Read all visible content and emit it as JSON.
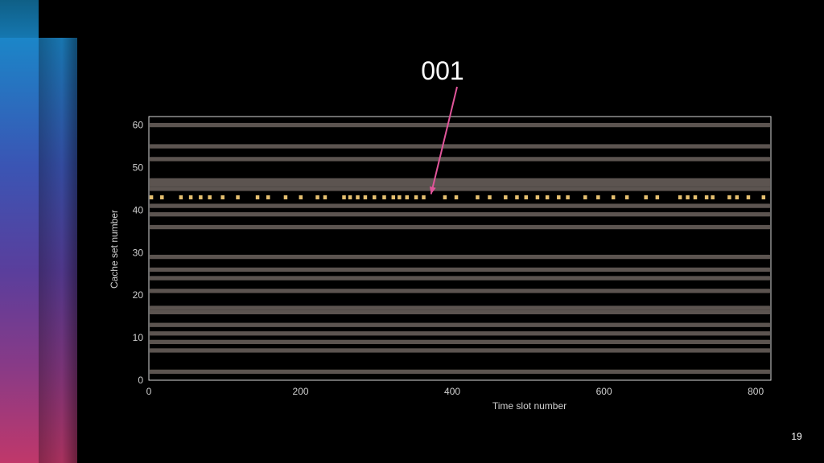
{
  "slide": {
    "title": "001",
    "page_number": "19"
  },
  "colors": {
    "background": "#000000",
    "band": "#5c5450",
    "band_dark": "#3e3835",
    "highlight": "#e6c070",
    "arrow": "#e0559a",
    "frame": "#d8d8d8"
  },
  "chart_data": {
    "type": "heatmap",
    "xlabel": "Time slot number",
    "ylabel": "Cache set number",
    "xlim": [
      0,
      820
    ],
    "ylim": [
      0,
      62
    ],
    "xticks": [
      0,
      200,
      400,
      600,
      800
    ],
    "yticks": [
      0,
      10,
      20,
      30,
      40,
      50,
      60
    ],
    "grid": false,
    "legend": "none",
    "active_sets": [
      2,
      7,
      9,
      11,
      13,
      16,
      17,
      21,
      24,
      26,
      29,
      36,
      39,
      41,
      45,
      46,
      47,
      52,
      55,
      60
    ],
    "highlighted_set": 43,
    "highlighted_slots": [
      3,
      17,
      42,
      55,
      68,
      80,
      97,
      117,
      143,
      157,
      180,
      200,
      222,
      232,
      257,
      265,
      275,
      285,
      297,
      310,
      322,
      330,
      340,
      352,
      362,
      390,
      405,
      433,
      449,
      470,
      485,
      497,
      512,
      525,
      540,
      552,
      575,
      592,
      612,
      630,
      655,
      670,
      700,
      710,
      720,
      735,
      743,
      765,
      775,
      790,
      810
    ],
    "annotation": {
      "text": "001",
      "points_to": {
        "x": 372,
        "y": 43
      }
    }
  }
}
